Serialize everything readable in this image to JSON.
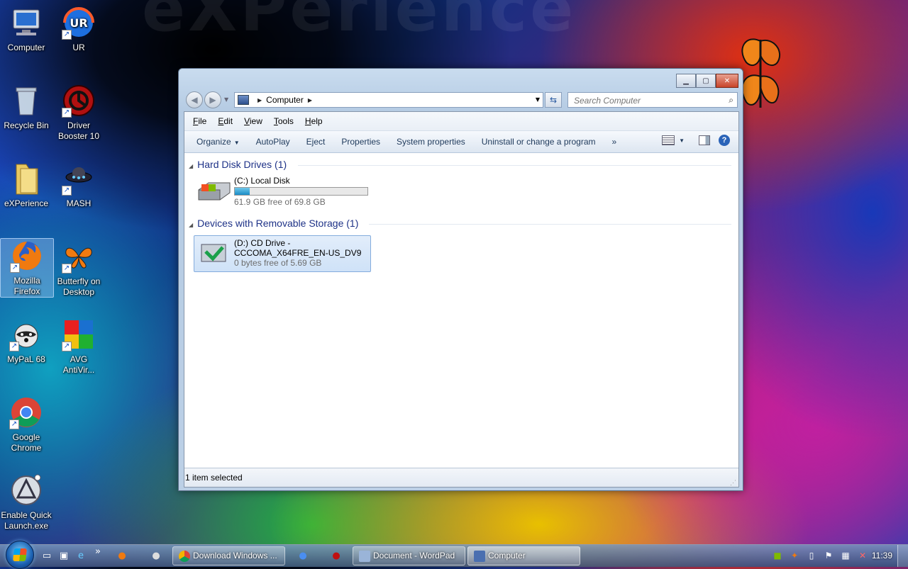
{
  "desktop": {
    "icons": [
      {
        "label": "Computer"
      },
      {
        "label": "UR"
      },
      {
        "label": "Recycle Bin"
      },
      {
        "label": "Driver\nBooster 10"
      },
      {
        "label": "eXPerience"
      },
      {
        "label": "MASH"
      },
      {
        "label": "Mozilla\nFirefox"
      },
      {
        "label": "Butterfly on\nDesktop"
      },
      {
        "label": "MyPaL 68"
      },
      {
        "label": "AVG\nAntiVir..."
      },
      {
        "label": "Google\nChrome"
      },
      {
        "label": "Enable Quick\nLaunch.exe"
      }
    ]
  },
  "window": {
    "breadcrumb": "Computer",
    "search_placeholder": "Search Computer",
    "menu": [
      "File",
      "Edit",
      "View",
      "Tools",
      "Help"
    ],
    "commands": [
      "Organize",
      "AutoPlay",
      "Eject",
      "Properties",
      "System properties",
      "Uninstall or change a program"
    ],
    "more_glyph": "»",
    "groups": [
      {
        "title": "Hard Disk Drives (1)"
      },
      {
        "title": "Devices with Removable Storage (1)"
      }
    ],
    "drives": [
      {
        "name": "(C:) Local Disk",
        "free_text": "61.9 GB free of 69.8 GB",
        "used_fraction": 0.113
      },
      {
        "name": "(D:) CD Drive -",
        "name2": "CCCOMA_X64FRE_EN-US_DV9",
        "free_text": "0 bytes free of 5.69 GB"
      }
    ],
    "status": "1 item selected"
  },
  "taskbar": {
    "tasks": [
      {
        "label": "Download Windows ..."
      },
      {
        "label": "Document - WordPad"
      },
      {
        "label": "Computer"
      }
    ],
    "clock": "11:39"
  },
  "colors": {
    "accent": "#1e3287",
    "selection": "#cfe2f8",
    "drive_bar": "#1a8cc6"
  }
}
